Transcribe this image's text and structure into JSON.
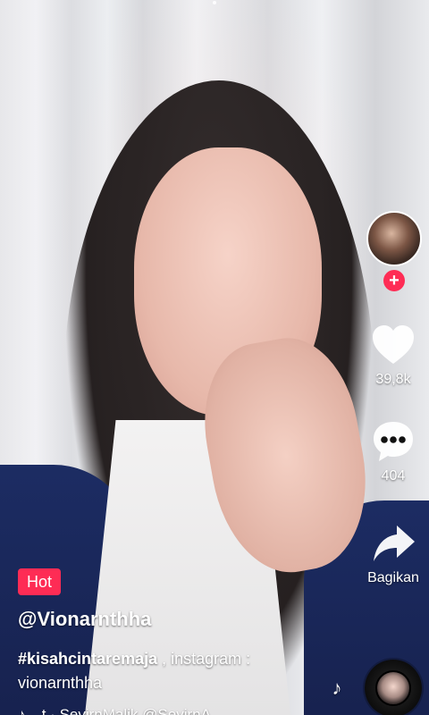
{
  "colors": {
    "accent": "#fe2c55",
    "text_on_dark": "#ffffff"
  },
  "rail": {
    "avatar": {
      "icon": "profile-avatar",
      "follow_plus": "+"
    },
    "like": {
      "icon": "heart-icon",
      "count": "39,8k"
    },
    "comment": {
      "icon": "comment-bubble-icon",
      "count": "404"
    },
    "share": {
      "icon": "share-arrow-icon",
      "label": "Bagikan"
    }
  },
  "post": {
    "badge": "Hot",
    "username": "@Vionarnthha",
    "caption_hashtag": "#kisahcintaremaja",
    "caption_rest": " , instagram : vionarnthha",
    "music_note_symbol": "♪",
    "music_text": "t · SevirnMalik   @SevirnA"
  },
  "music": {
    "floating_note": "♪",
    "disc_icon": "music-disc-icon"
  }
}
